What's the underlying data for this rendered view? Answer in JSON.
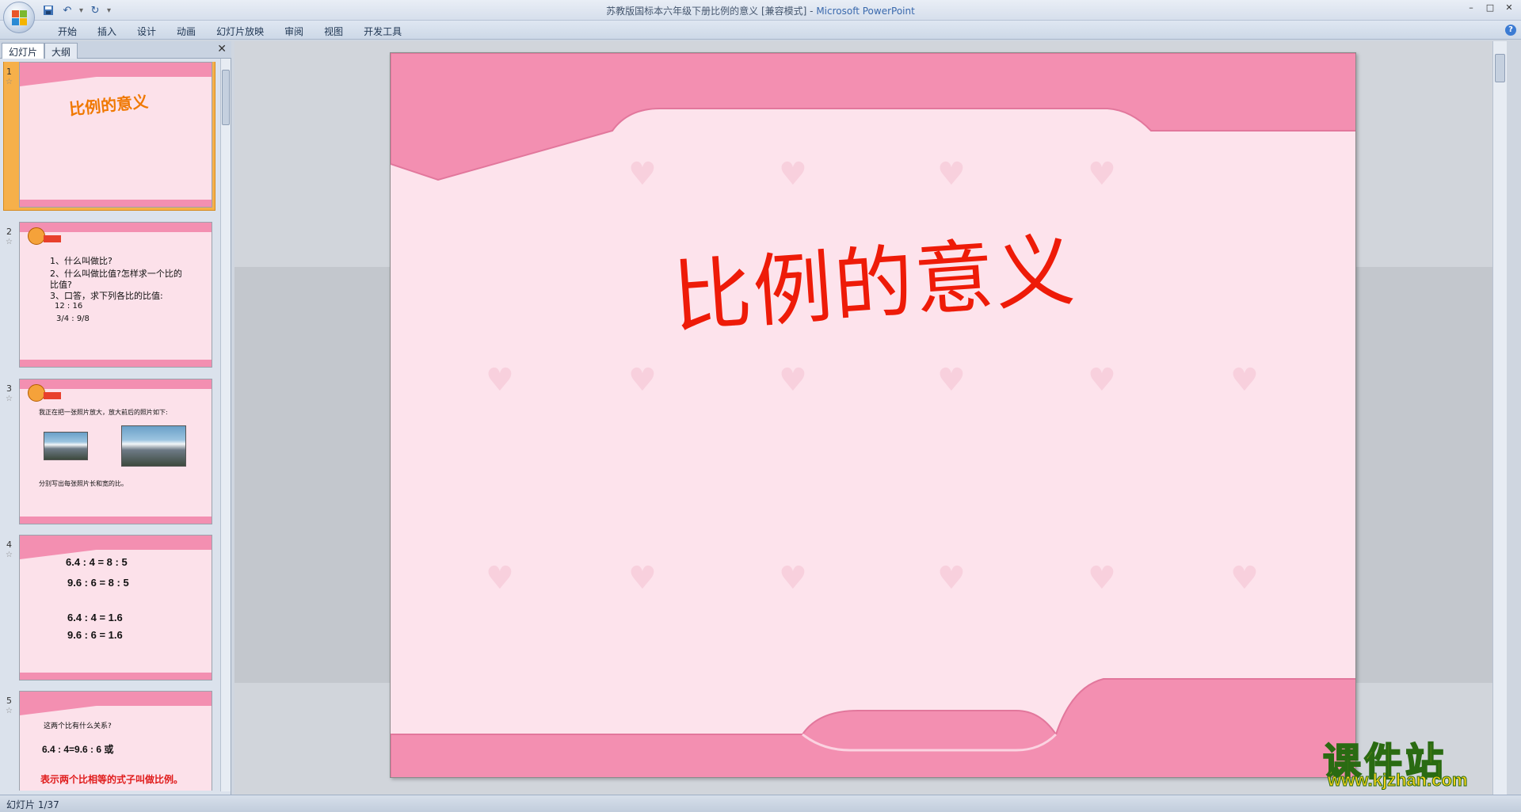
{
  "window": {
    "title_doc": "苏教版国标本六年级下册比例的意义 [兼容模式]",
    "title_sep": " - ",
    "title_app": "Microsoft PowerPoint",
    "controls": [
      "–",
      "□",
      "✕"
    ]
  },
  "ribbon": {
    "tabs": [
      "开始",
      "插入",
      "设计",
      "动画",
      "幻灯片放映",
      "审阅",
      "视图",
      "开发工具"
    ],
    "help": "?"
  },
  "pane": {
    "tab_slides": "幻灯片",
    "tab_outline": "大纲",
    "close": "✕"
  },
  "thumbnails": [
    {
      "num": "1",
      "star": "☆",
      "title": "比例的意义"
    },
    {
      "num": "2",
      "star": "☆",
      "lines": [
        "1、什么叫做比?",
        "2、什么叫做比值?怎样求一个比的",
        "比值?",
        "3、口答，求下列各比的比值:",
        "12 : 16",
        "3/4 : 9/8"
      ]
    },
    {
      "num": "3",
      "star": "☆",
      "lines": [
        "我正在把一张照片放大，放大前后的照片如下:",
        "分别写出每张照片长和宽的比。"
      ]
    },
    {
      "num": "4",
      "star": "☆",
      "lines": [
        "6.4 : 4 = 8 : 5",
        "9.6 : 6 = 8 : 5",
        "6.4 : 4 = 1.6",
        "9.6 : 6 = 1.6"
      ]
    },
    {
      "num": "5",
      "star": "☆",
      "lines": [
        "这两个比有什么关系?",
        "6.4 : 4=9.6 : 6  或",
        "表示两个比相等的式子叫做比例。"
      ]
    }
  ],
  "slide": {
    "title": "比例的意义"
  },
  "status": {
    "slide_counter": "幻灯片 1/37"
  },
  "watermark": {
    "cn": "课件站",
    "url": "www.kjzhan.com"
  },
  "colors": {
    "slide_bg": "#fde3ec",
    "pink_band": "#f38fb1",
    "title_red": "#ee1b08",
    "selection_orange": "#f6b04a"
  }
}
